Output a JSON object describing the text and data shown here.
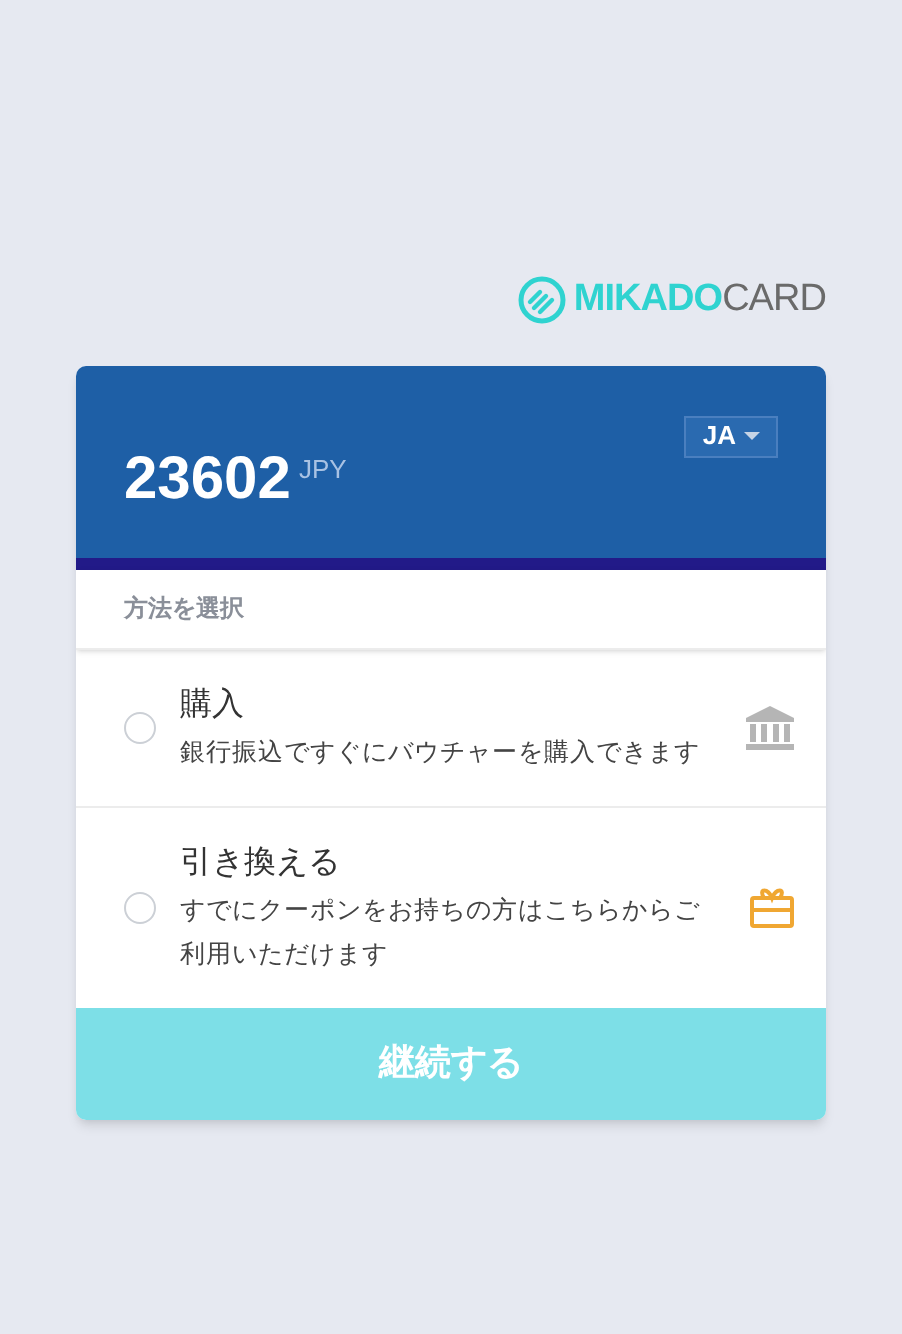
{
  "logo": {
    "primary": "MIKADO",
    "secondary": "CARD"
  },
  "amount": {
    "value": "23602",
    "currency": "JPY"
  },
  "language": {
    "label": "JA"
  },
  "section_label": "方法を選択",
  "options": [
    {
      "title": "購入",
      "description": "銀行振込ですぐにバウチャーを購入できます",
      "selected": false,
      "kind": "bank"
    },
    {
      "title": "引き換える",
      "description": "すでにクーポンをお持ちの方はこちらからご利用いただけます",
      "selected": false,
      "kind": "gift"
    }
  ],
  "continue_button": {
    "label": "継続する",
    "disabled": true
  }
}
